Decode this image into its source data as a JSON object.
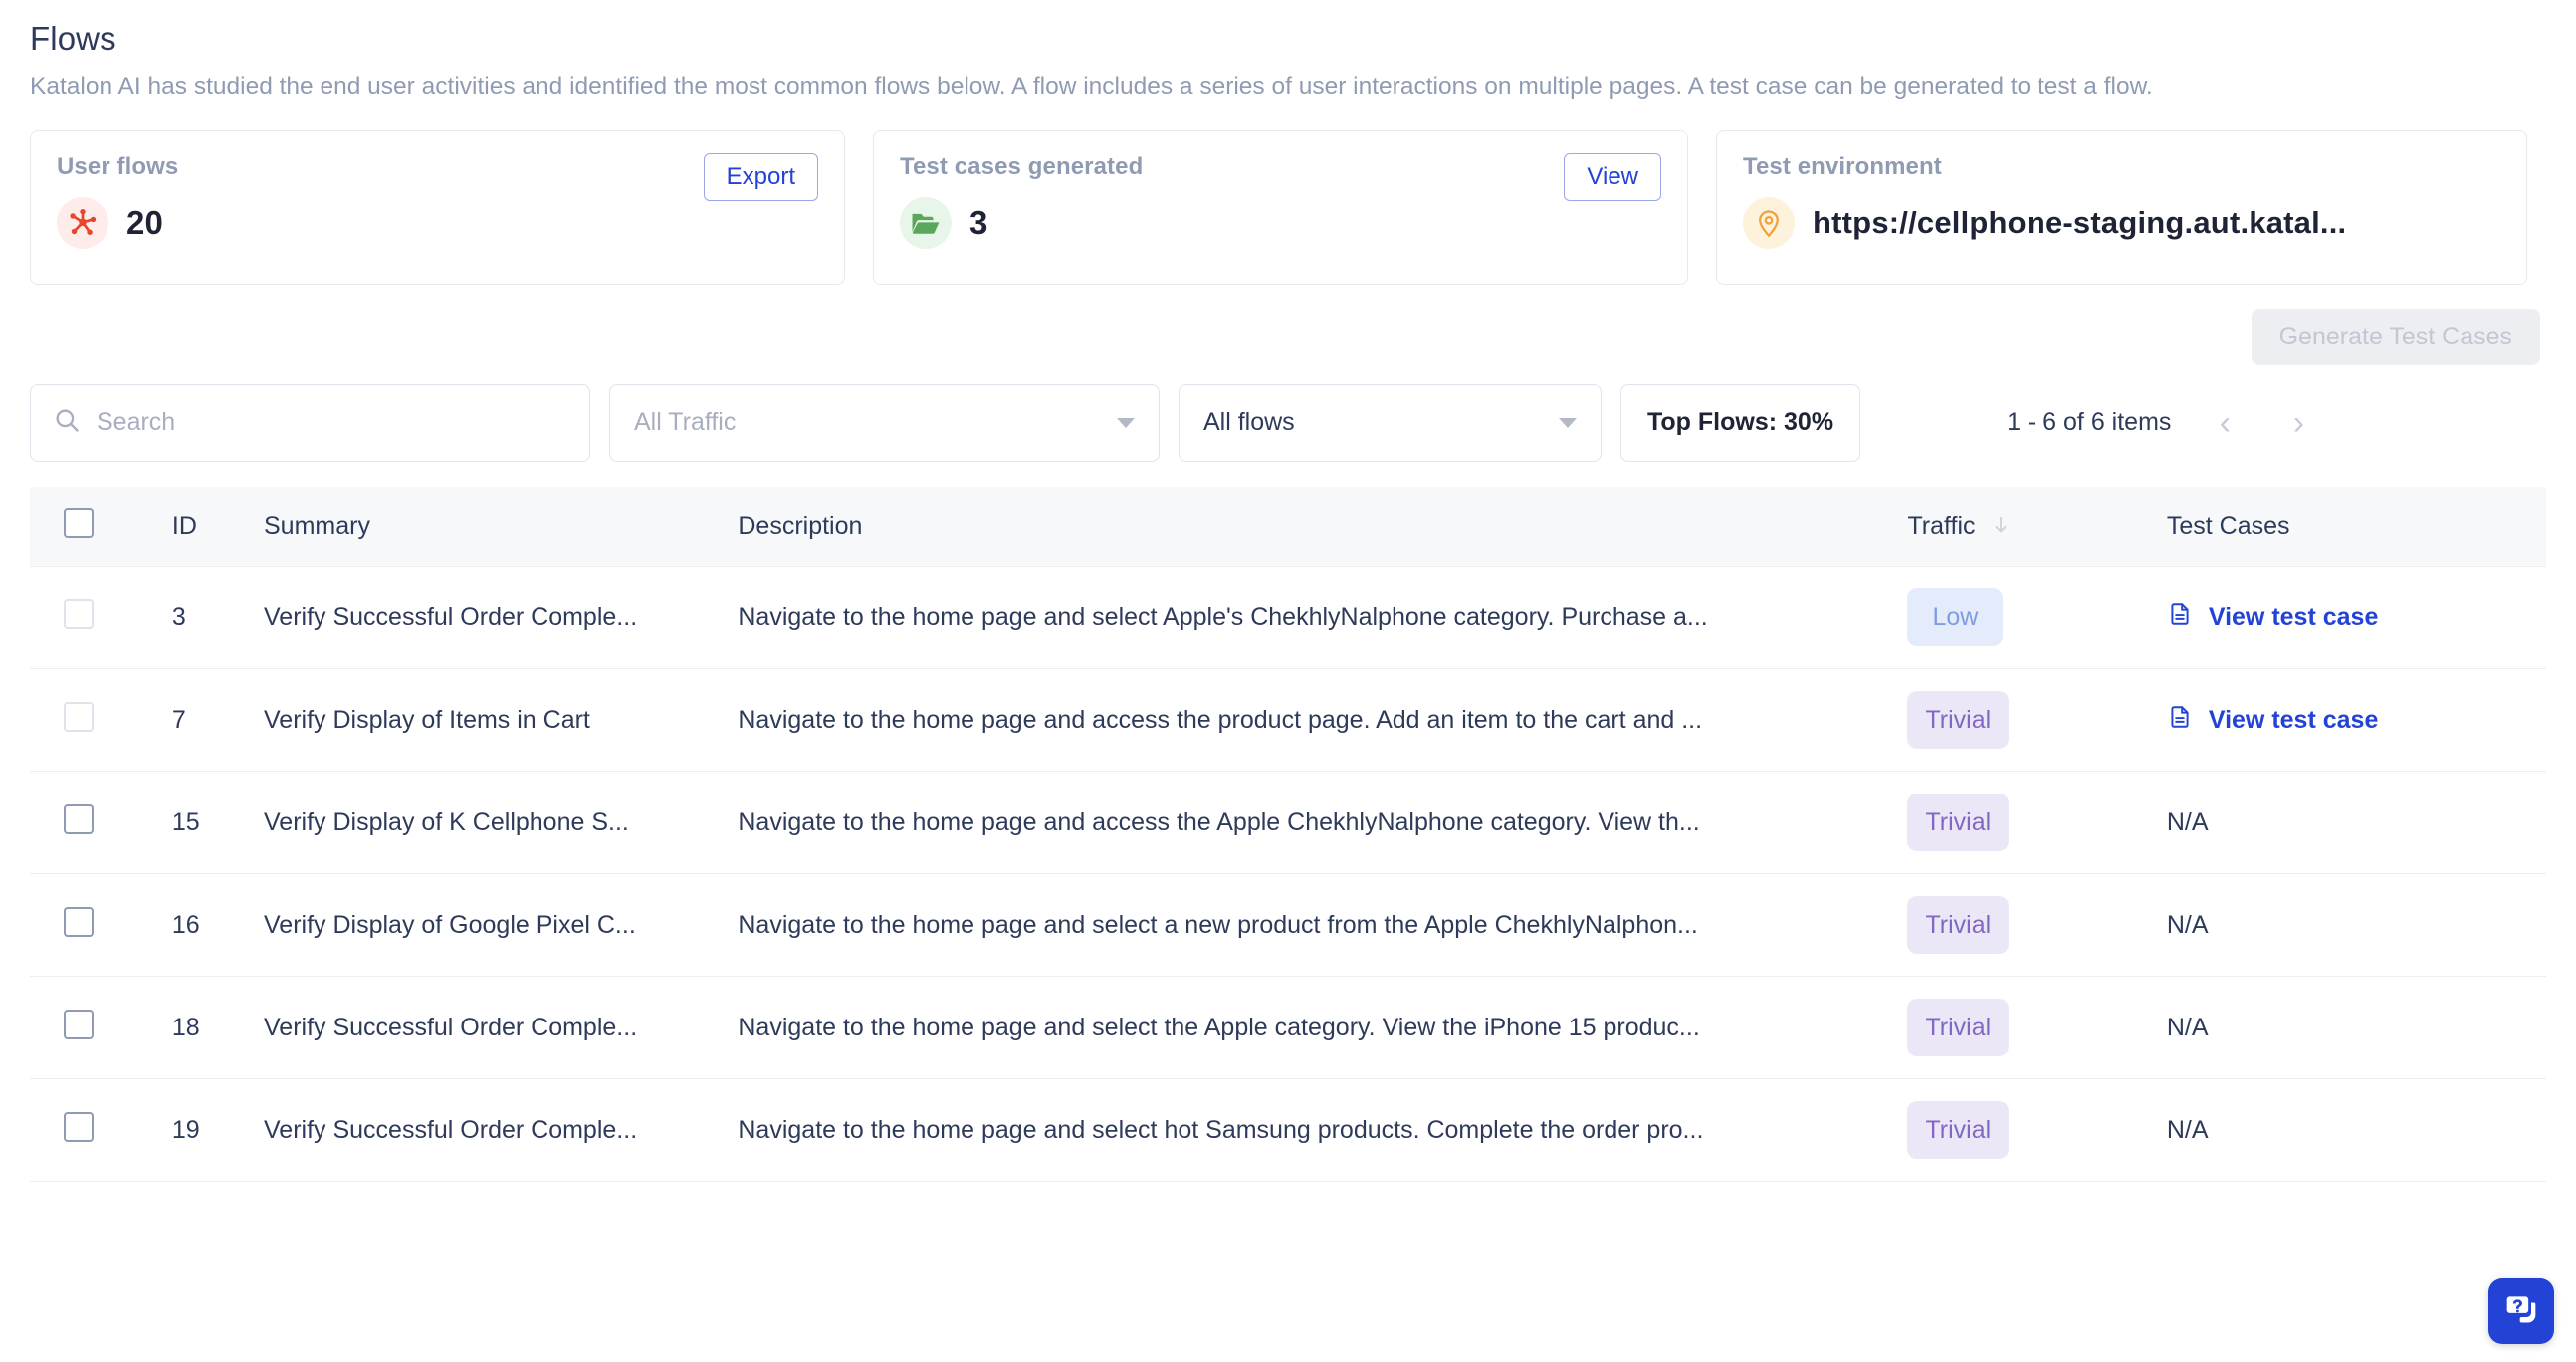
{
  "header": {
    "title": "Flows",
    "description": "Katalon AI has studied the end user activities and identified the most common flows below. A flow includes a series of user interactions on multiple pages. A test case can be generated to test a flow."
  },
  "cards": [
    {
      "label": "User flows",
      "value": "20",
      "button": "Export",
      "icon": "flow-network-icon"
    },
    {
      "label": "Test cases generated",
      "value": "3",
      "button": "View",
      "icon": "folder-icon"
    },
    {
      "label": "Test environment",
      "value": "https://cellphone-staging.aut.katal...",
      "button": null,
      "icon": "location-pin-icon"
    }
  ],
  "actions": {
    "generate_test_cases": "Generate Test Cases"
  },
  "toolbar": {
    "search_placeholder": "Search",
    "search_value": "",
    "traffic_filter": "All Traffic",
    "flows_filter": "All flows",
    "top_flows": "Top Flows: 30%"
  },
  "pagination": {
    "range": "1 - 6 of 6 items",
    "prev": "‹",
    "next": "›"
  },
  "table": {
    "columns": [
      "",
      "ID",
      "Summary",
      "Description",
      "Traffic",
      "Test Cases"
    ],
    "sorted_column": "Traffic",
    "sort_direction": "desc",
    "rows": [
      {
        "id": "3",
        "summary": "Verify Successful Order Comple...",
        "description": "Navigate to the home page and select Apple's ChekhlyNalphone category. Purchase a...",
        "traffic": "Low",
        "traffic_style": "low",
        "test_case": "View test case",
        "has_test_case": true,
        "checkbox_disabled": true
      },
      {
        "id": "7",
        "summary": "Verify Display of Items in Cart",
        "description": "Navigate to the home page and access the product page. Add an item to the cart and ...",
        "traffic": "Trivial",
        "traffic_style": "trivial",
        "test_case": "View test case",
        "has_test_case": true,
        "checkbox_disabled": true
      },
      {
        "id": "15",
        "summary": "Verify Display of K Cellphone S...",
        "description": "Navigate to the home page and access the Apple ChekhlyNalphone category. View th...",
        "traffic": "Trivial",
        "traffic_style": "trivial",
        "test_case": "N/A",
        "has_test_case": false,
        "checkbox_disabled": false
      },
      {
        "id": "16",
        "summary": "Verify Display of Google Pixel C...",
        "description": "Navigate to the home page and select a new product from the Apple ChekhlyNalphon...",
        "traffic": "Trivial",
        "traffic_style": "trivial",
        "test_case": "N/A",
        "has_test_case": false,
        "checkbox_disabled": false
      },
      {
        "id": "18",
        "summary": "Verify Successful Order Comple...",
        "description": "Navigate to the home page and select the Apple category. View the iPhone 15 produc...",
        "traffic": "Trivial",
        "traffic_style": "trivial",
        "test_case": "N/A",
        "has_test_case": false,
        "checkbox_disabled": false
      },
      {
        "id": "19",
        "summary": "Verify Successful Order Comple...",
        "description": "Navigate to the home page and select hot Samsung products. Complete the order pro...",
        "traffic": "Trivial",
        "traffic_style": "trivial",
        "test_case": "N/A",
        "has_test_case": false,
        "checkbox_disabled": false
      }
    ]
  },
  "help_widget": {
    "icon": "help-chat-icon"
  },
  "colors": {
    "accent_blue": "#2342d6",
    "text_dark": "#2e3a59",
    "text_muted": "#8f9bb3",
    "flows_icon": "#e8452c",
    "folder_icon": "#5aa75c",
    "pin_icon": "#f2a03d",
    "badge_low_bg": "#e4ecfb",
    "badge_low_text": "#7f9ce0",
    "badge_trivial_bg": "#ece7f7",
    "badge_trivial_text": "#8267c4"
  }
}
